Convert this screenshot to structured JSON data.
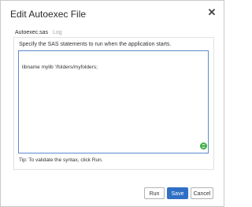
{
  "dialog": {
    "title": "Edit Autoexec File",
    "close_icon": "close-icon"
  },
  "tabs": [
    {
      "label": "Autoexec.sas",
      "active": true
    },
    {
      "label": "Log",
      "active": false
    }
  ],
  "panel": {
    "instructions": "Specify the SAS statements to run when the application starts.",
    "editor_content": "libname mylib '/folders/myfolders;",
    "grammar_icon": "grammar-check-icon",
    "tip": "Tip: To validate the syntax, click Run."
  },
  "buttons": {
    "run": "Run",
    "save": "Save",
    "cancel": "Cancel"
  },
  "colors": {
    "accent": "#2f6fc5",
    "editor_border": "#5b8ad0",
    "icon_green": "#3fae49"
  }
}
